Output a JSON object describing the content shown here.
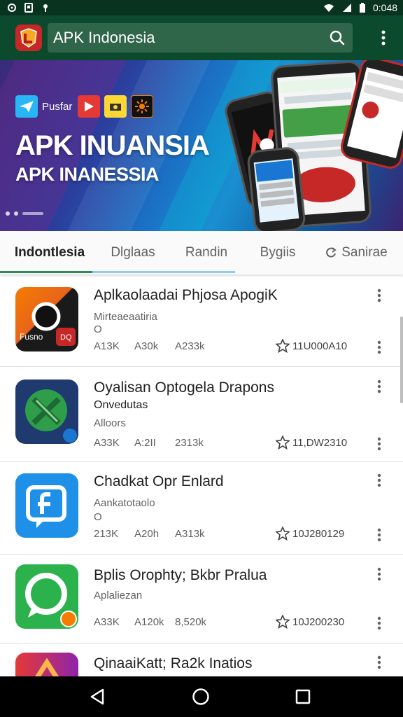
{
  "status_bar": {
    "time": "0:048",
    "icons": [
      "sync-icon",
      "save-icon",
      "notification-icon",
      "wifi-icon",
      "signal-icon",
      "battery-icon"
    ]
  },
  "toolbar": {
    "search_value": "APK Indonesia",
    "search_icon": "search-icon",
    "menu_icon": "more-vert-icon",
    "accent": "#0c4a2e"
  },
  "banner": {
    "badge_label": "Pusfar",
    "title": "APK INUANSIA",
    "subtitle": "APK INANESSIA"
  },
  "tabs": [
    {
      "label": "Indontlesia",
      "active": true
    },
    {
      "label": "Dlglaas",
      "active": false
    },
    {
      "label": "Randin",
      "active": false
    },
    {
      "label": "Bygiis",
      "active": false
    },
    {
      "label": "Sanirae",
      "active": false
    }
  ],
  "apps": [
    {
      "title": "Aplkaolaadai Phjosa ApogiK",
      "subtitle": "Mirteaeaatiria",
      "subtitle2": "O",
      "stats": [
        "A13K",
        "A30k",
        "A233k"
      ],
      "rating": "11U000A10",
      "icon_badge": "Fusno",
      "icon_badge2": "DQ",
      "icon_color": "#e8641b"
    },
    {
      "title": "Oyalisan Optogela Drapons",
      "subtitle": "Onvedutas",
      "subtitle2": "Alloors",
      "stats": [
        "A33K",
        "A:2II",
        "2313k"
      ],
      "rating": "11,DW2310",
      "icon_color": "#1e3a6e"
    },
    {
      "title": "Chadkat Opr Enlard",
      "subtitle": "Aankatotaolo",
      "subtitle2": "O",
      "stats": [
        "213K",
        "A20h",
        "A313k"
      ],
      "rating": "10J280129",
      "icon_color": "#1e90e8"
    },
    {
      "title": "Bplis Orophty; Bkbr Pralua",
      "subtitle": "Aplaliezan",
      "subtitle2": "",
      "stats": [
        "A33K",
        "A120k",
        "8,520k"
      ],
      "rating": "10J200230",
      "icon_color": "#2bb24c"
    },
    {
      "title": "QinaaiKatt; Ra2k Inatios",
      "subtitle": "",
      "subtitle2": "",
      "stats": [],
      "rating": "",
      "icon_color": "#e53935"
    }
  ]
}
